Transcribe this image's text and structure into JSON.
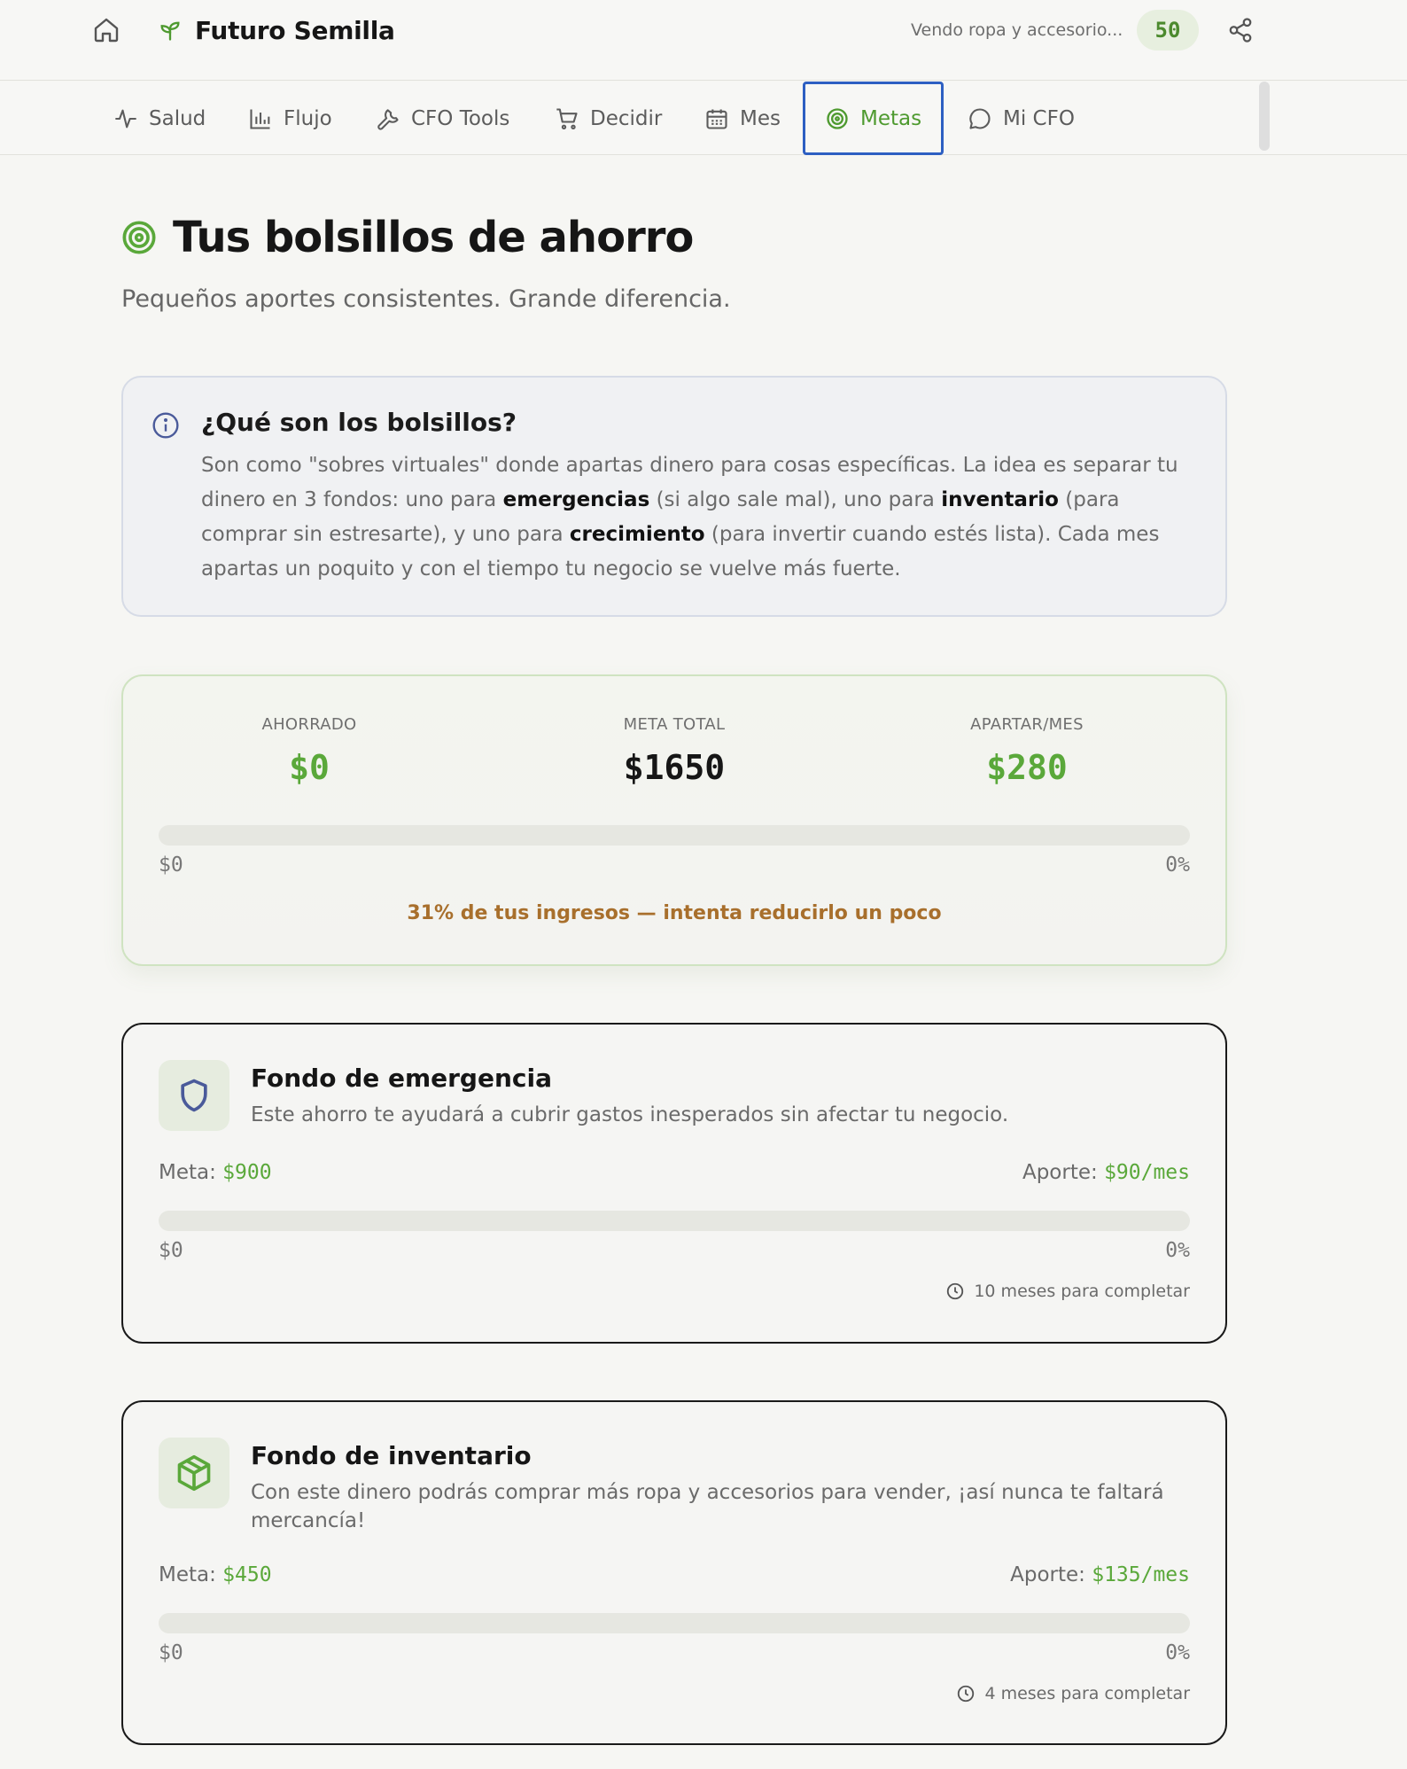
{
  "header": {
    "brand_name": "Futuro Semilla",
    "business_description": "Vendo ropa y accesorio...",
    "score": "50",
    "icons": {
      "home": "home-icon",
      "logo": "sprout-icon",
      "share": "share-icon"
    }
  },
  "tabs": [
    {
      "label": "Salud",
      "icon": "activity-icon",
      "active": false
    },
    {
      "label": "Flujo",
      "icon": "bar-chart-icon",
      "active": false
    },
    {
      "label": "CFO Tools",
      "icon": "wrench-icon",
      "active": false
    },
    {
      "label": "Decidir",
      "icon": "cart-icon",
      "active": false
    },
    {
      "label": "Mes",
      "icon": "calendar-icon",
      "active": false
    },
    {
      "label": "Metas",
      "icon": "target-icon",
      "active": true
    },
    {
      "label": "Mi CFO",
      "icon": "chat-icon",
      "active": false
    }
  ],
  "page": {
    "title": "Tus bolsillos de ahorro",
    "subtitle": "Pequeños aportes consistentes. Grande diferencia."
  },
  "info": {
    "title": "¿Qué son los bolsillos?",
    "body_1": "Son como \"sobres virtuales\" donde apartas dinero para cosas específicas. La idea es separar tu dinero en 3 fondos: uno para ",
    "bold_1": "emergencias",
    "body_2": " (si algo sale mal), uno para ",
    "bold_2": "inventario",
    "body_3": " (para comprar sin estresarte), y uno para ",
    "bold_3": "crecimiento",
    "body_4": " (para invertir cuando estés lista). Cada mes apartas un poquito y con el tiempo tu negocio se vuelve más fuerte."
  },
  "summary": {
    "saved_label": "AHORRADO",
    "saved_value": "$0",
    "goal_label": "META TOTAL",
    "goal_value": "$1650",
    "monthly_label": "APARTAR/MES",
    "monthly_value": "$280",
    "progress_amount": "$0",
    "progress_percent": "0%",
    "progress_fraction": 0,
    "warning": "31% de tus ingresos — intenta reducirlo un poco"
  },
  "funds": [
    {
      "title": "Fondo de emergencia",
      "icon": "shield-icon",
      "description": "Este ahorro te ayudará a cubrir gastos inesperados sin afectar tu negocio.",
      "meta_label": "Meta:",
      "meta_value": "$900",
      "aporte_label": "Aporte:",
      "aporte_value": "$90/mes",
      "progress_amount": "$0",
      "progress_percent": "0%",
      "progress_fraction": 0,
      "completion": "10 meses para completar"
    },
    {
      "title": "Fondo de inventario",
      "icon": "box-icon",
      "description": "Con este dinero podrás comprar más ropa y accesorios para vender, ¡así nunca te faltará mercancía!",
      "meta_label": "Meta:",
      "meta_value": "$450",
      "aporte_label": "Aporte:",
      "aporte_value": "$135/mes",
      "progress_amount": "$0",
      "progress_percent": "0%",
      "progress_fraction": 0,
      "completion": "4 meses para completar"
    }
  ],
  "colors": {
    "accent_green": "#5aa83a",
    "active_tab_border": "#2d5fc2",
    "warning": "#a86f2c",
    "info_icon": "#4a5a9a"
  }
}
